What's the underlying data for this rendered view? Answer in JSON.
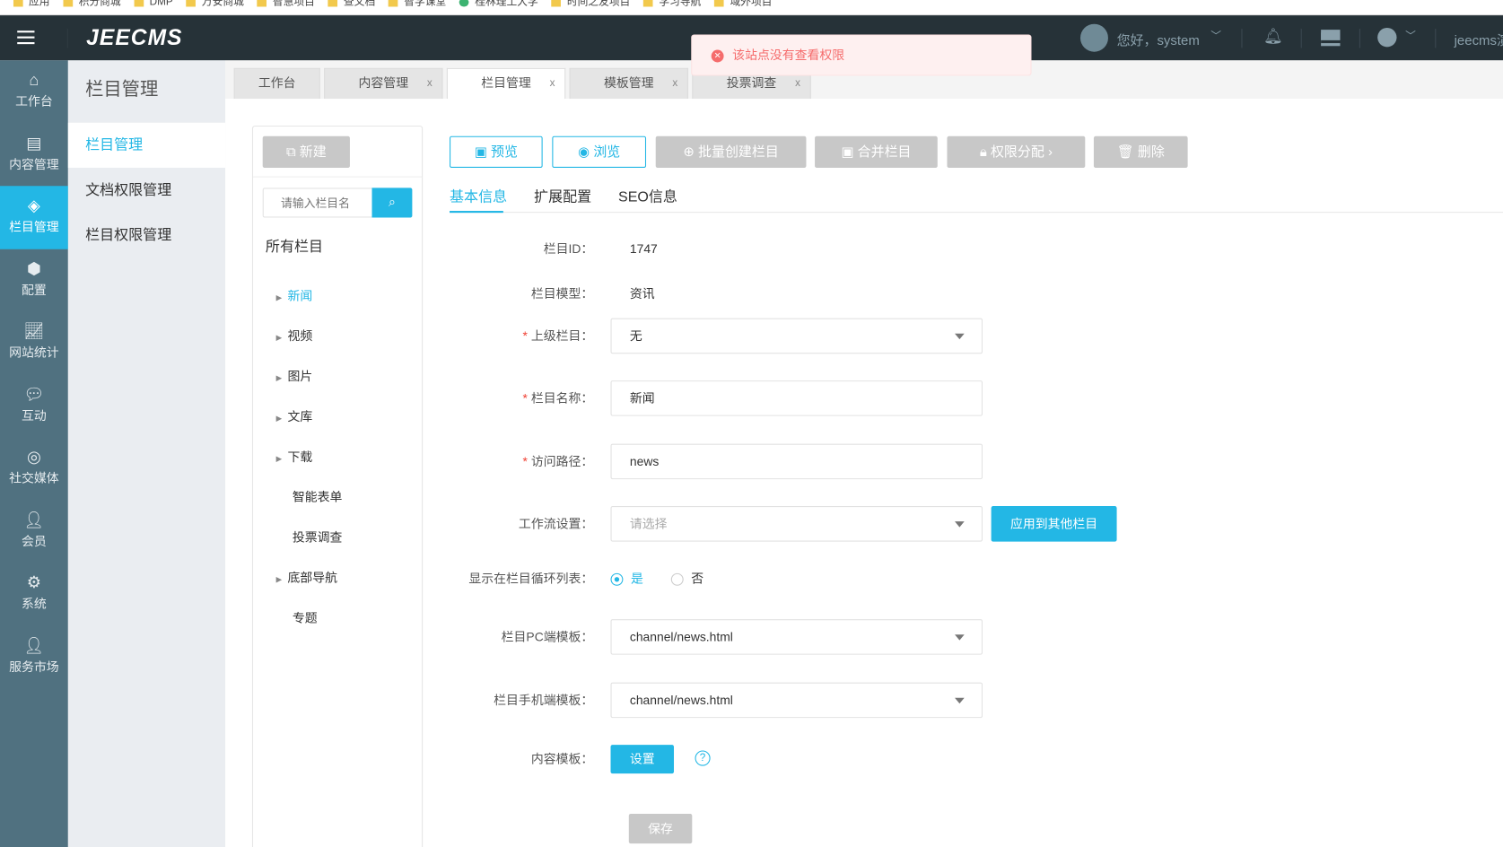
{
  "bookmarks": [
    "应用",
    "积分商城",
    "DMP",
    "万安商城",
    "智慧项目",
    "查文档",
    "智学课堂",
    "桂林理工大学",
    "时间之友项目",
    "学习导航",
    "域外项目"
  ],
  "header": {
    "logo": "JEECMS",
    "greeting": "您好，system",
    "site": "jeecms演"
  },
  "toast": {
    "message": "该站点没有查看权限",
    "color": "#f56c6c"
  },
  "sidebar": {
    "items": [
      {
        "label": "工作台",
        "icon": "home-icon"
      },
      {
        "label": "内容管理",
        "icon": "document-icon"
      },
      {
        "label": "栏目管理",
        "icon": "layers-icon"
      },
      {
        "label": "配置",
        "icon": "box-icon"
      },
      {
        "label": "网站统计",
        "icon": "chart-icon"
      },
      {
        "label": "互动",
        "icon": "chat-icon"
      },
      {
        "label": "社交媒体",
        "icon": "social-icon"
      },
      {
        "label": "会员",
        "icon": "member-icon"
      },
      {
        "label": "系统",
        "icon": "gear-icon"
      },
      {
        "label": "服务市场",
        "icon": "service-icon"
      }
    ],
    "accent": "#23b7e5"
  },
  "submenu": {
    "title": "栏目管理",
    "items": [
      "栏目管理",
      "文档权限管理",
      "栏目权限管理"
    ]
  },
  "tabs": [
    {
      "label": "工作台"
    },
    {
      "label": "内容管理",
      "close": "x"
    },
    {
      "label": "栏目管理",
      "close": "x"
    },
    {
      "label": "模板管理",
      "close": "x"
    },
    {
      "label": "投票调查",
      "close": "x"
    }
  ],
  "tree": {
    "new_label": "新建",
    "search_placeholder": "请输入栏目名",
    "root": "所有栏目",
    "nodes": [
      "新闻",
      "视频",
      "图片",
      "文库",
      "下载",
      "智能表单",
      "投票调查",
      "底部导航",
      "专题"
    ]
  },
  "toolbar": {
    "preview": "预览",
    "browse": "浏览",
    "batch_create": "批量创建栏目",
    "merge": "合并栏目",
    "permission": "权限分配",
    "delete": "删除"
  },
  "form_tabs": [
    "基本信息",
    "扩展配置",
    "SEO信息"
  ],
  "form": {
    "id_label": "栏目ID：",
    "id_value": "1747",
    "model_label": "栏目模型：",
    "model_value": "资讯",
    "parent_label": "上级栏目：",
    "parent_value": "无",
    "name_label": "栏目名称：",
    "name_value": "新闻",
    "path_label": "访问路径：",
    "path_value": "news",
    "workflow_label": "工作流设置：",
    "workflow_placeholder": "请选择",
    "apply_other": "应用到其他栏目",
    "show_label": "显示在栏目循环列表：",
    "yes": "是",
    "no": "否",
    "pc_label": "栏目PC端模板：",
    "pc_value": "channel/news.html",
    "mobile_label": "栏目手机端模板：",
    "mobile_value": "channel/news.html",
    "content_label": "内容模板：",
    "set": "设置",
    "save": "保存",
    "required": "*"
  }
}
